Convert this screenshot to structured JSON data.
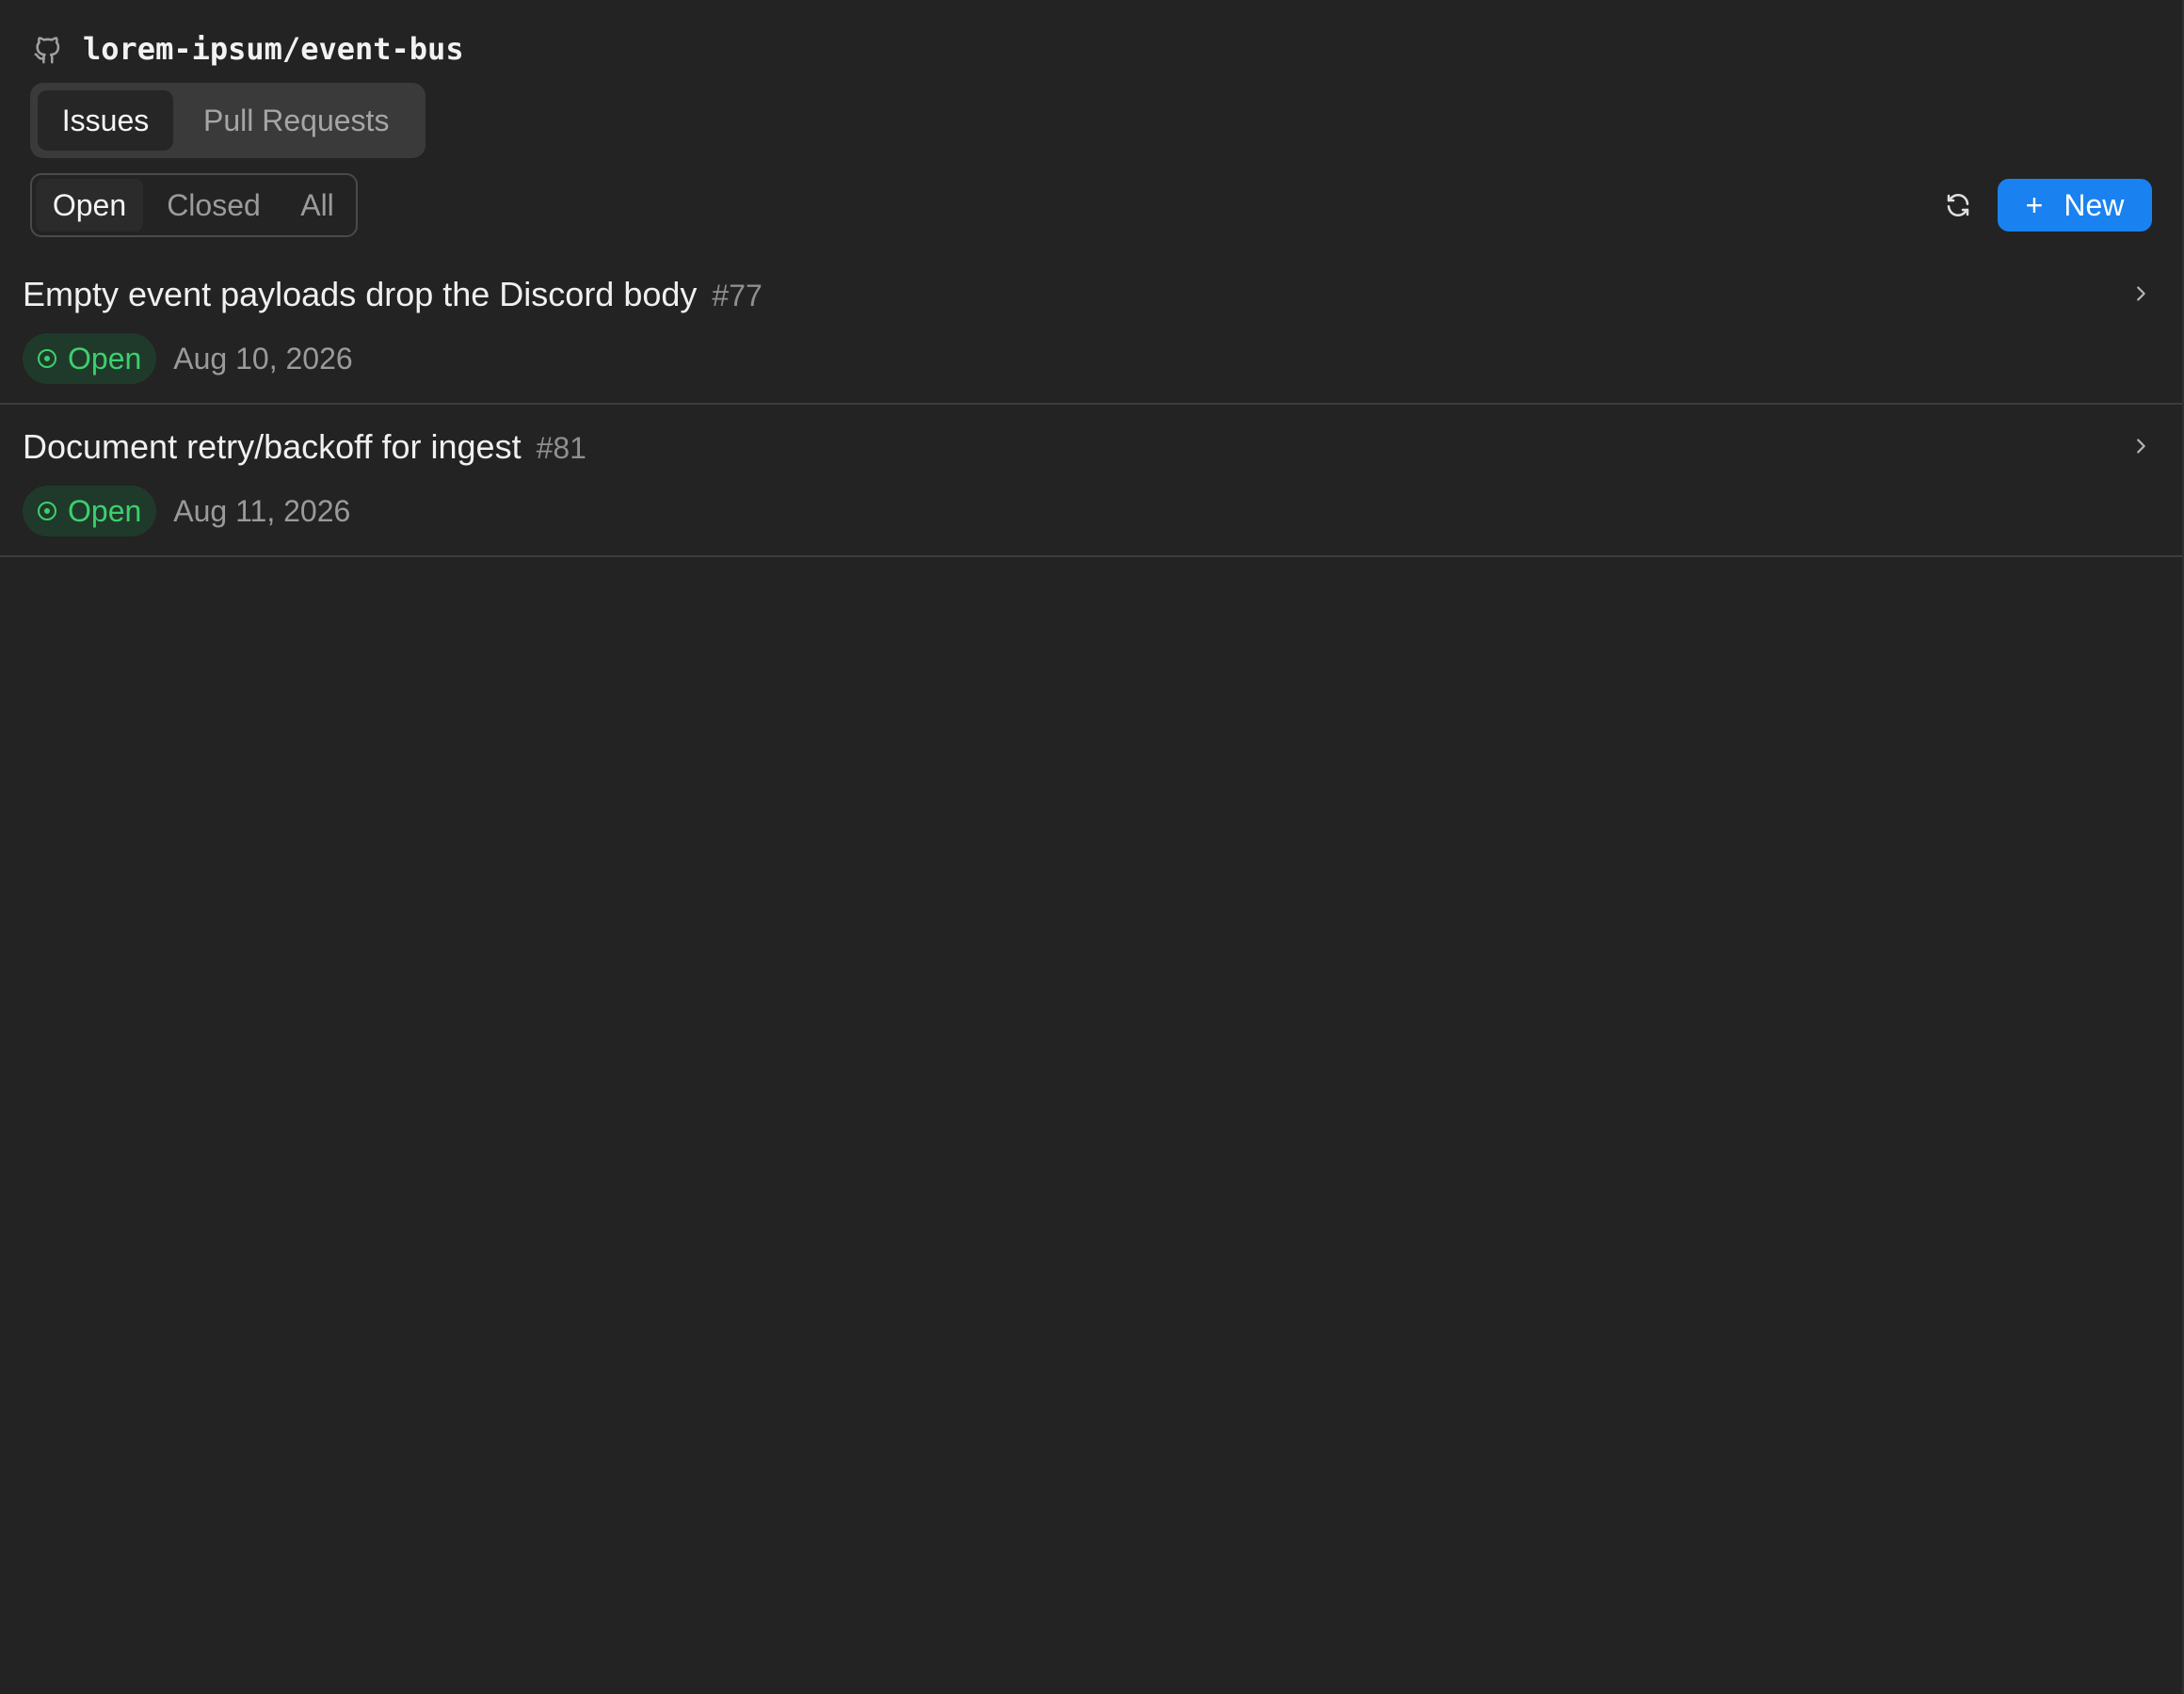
{
  "repo": {
    "name": "lorem-ipsum/event-bus",
    "icon": "github-icon"
  },
  "tabs": [
    {
      "label": "Issues",
      "active": true
    },
    {
      "label": "Pull Requests",
      "active": false
    }
  ],
  "filter": {
    "open_label": "Open",
    "closed_label": "Closed",
    "all_label": "All",
    "selected": "Open"
  },
  "actions": {
    "refresh_icon": "refresh-icon",
    "new_plus": "+",
    "new_label": "New"
  },
  "issues": [
    {
      "title": "Empty event payloads drop the Discord body",
      "number": "#77",
      "status": "Open",
      "date": "Aug 10, 2026"
    },
    {
      "title": "Document retry/backoff for ingest",
      "number": "#81",
      "status": "Open",
      "date": "Aug 11, 2026"
    }
  ],
  "colors": {
    "background": "#232323",
    "accent": "#1a82f0",
    "open_status": "#3ecf6e",
    "open_badge_bg": "#1f3a2a"
  }
}
